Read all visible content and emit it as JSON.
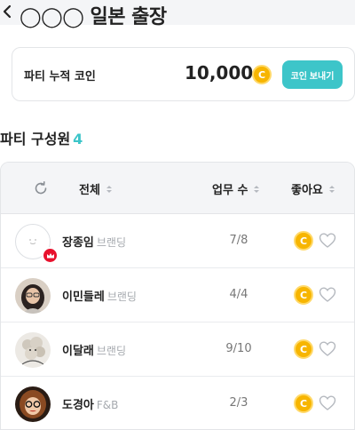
{
  "header": {
    "title": "◯◯◯ 일본 출장"
  },
  "coin_card": {
    "label": "파티 누적 코인",
    "amount": "10,000",
    "coin_symbol": "C",
    "send_label": "코인 보내기"
  },
  "members": {
    "title": "파티 구성원",
    "count": "4"
  },
  "table": {
    "columns": {
      "all": "전체",
      "tasks": "업무 수",
      "likes": "좋아요"
    },
    "rows": [
      {
        "name": "장종임",
        "team": "브랜딩",
        "tasks": "7/8",
        "coin": "C"
      },
      {
        "name": "이민들레",
        "team": "브랜딩",
        "tasks": "4/4",
        "coin": "C"
      },
      {
        "name": "이달래",
        "team": "브랜딩",
        "tasks": "9/10",
        "coin": "C"
      },
      {
        "name": "도경아",
        "team": "F&B",
        "tasks": "2/3",
        "coin": "C"
      }
    ]
  },
  "colors": {
    "accent": "#3dc5c9",
    "coin": "#f7b500",
    "crown_badge": "#e8112d",
    "header_bg": "#f4f5f7"
  },
  "icons": [
    "back-icon",
    "coin-icon",
    "refresh-icon",
    "sort-icon",
    "crown-icon",
    "heart-icon"
  ]
}
